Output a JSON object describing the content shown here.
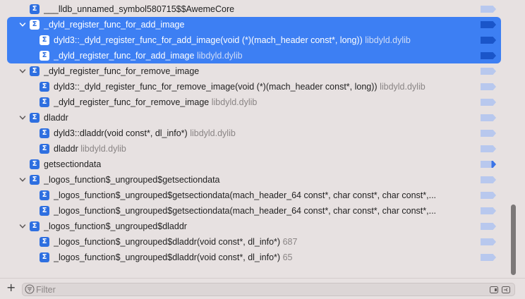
{
  "rows": [
    {
      "indent": 1,
      "disclosure": "none",
      "name": "___lldb_unnamed_symbol580715$$AwemeCore",
      "lib": "",
      "selected": false,
      "bp": "normal"
    },
    {
      "indent": 0,
      "disclosure": "open",
      "name": "_dyld_register_func_for_add_image",
      "lib": "",
      "selected": true,
      "bp": "normal"
    },
    {
      "indent": 2,
      "disclosure": "none",
      "name": "dyld3::_dyld_register_func_for_add_image(void (*)(mach_header const*, long))",
      "lib": "libdyld.dylib",
      "selected": true,
      "bp": "normal"
    },
    {
      "indent": 2,
      "disclosure": "none",
      "name": "_dyld_register_func_for_add_image",
      "lib": "libdyld.dylib",
      "selected": true,
      "bp": "normal"
    },
    {
      "indent": 0,
      "disclosure": "open",
      "name": "_dyld_register_func_for_remove_image",
      "lib": "",
      "selected": false,
      "bp": "normal"
    },
    {
      "indent": 2,
      "disclosure": "none",
      "name": "dyld3::_dyld_register_func_for_remove_image(void (*)(mach_header const*, long))",
      "lib": "libdyld.dylib",
      "selected": false,
      "bp": "normal"
    },
    {
      "indent": 2,
      "disclosure": "none",
      "name": "_dyld_register_func_for_remove_image",
      "lib": "libdyld.dylib",
      "selected": false,
      "bp": "normal"
    },
    {
      "indent": 0,
      "disclosure": "open",
      "name": "dladdr",
      "lib": "",
      "selected": false,
      "bp": "normal"
    },
    {
      "indent": 2,
      "disclosure": "none",
      "name": "dyld3::dladdr(void const*, dl_info*)",
      "lib": "libdyld.dylib",
      "selected": false,
      "bp": "normal"
    },
    {
      "indent": 2,
      "disclosure": "none",
      "name": "dladdr",
      "lib": "libdyld.dylib",
      "selected": false,
      "bp": "normal"
    },
    {
      "indent": 1,
      "disclosure": "none",
      "name": "getsectiondata",
      "lib": "",
      "selected": false,
      "bp": "partial"
    },
    {
      "indent": 0,
      "disclosure": "open",
      "name": "_logos_function$_ungrouped$getsectiondata",
      "lib": "",
      "selected": false,
      "bp": "normal"
    },
    {
      "indent": 2,
      "disclosure": "none",
      "name": "_logos_function$_ungrouped$getsectiondata(mach_header_64 const*, char const*, char const*,...",
      "lib": "",
      "selected": false,
      "bp": "normal"
    },
    {
      "indent": 2,
      "disclosure": "none",
      "name": "_logos_function$_ungrouped$getsectiondata(mach_header_64 const*, char const*, char const*,...",
      "lib": "",
      "selected": false,
      "bp": "normal"
    },
    {
      "indent": 0,
      "disclosure": "open",
      "name": "_logos_function$_ungrouped$dladdr",
      "lib": "",
      "selected": false,
      "bp": "normal"
    },
    {
      "indent": 2,
      "disclosure": "none",
      "name": "_logos_function$_ungrouped$dladdr(void const*, dl_info*)",
      "lib": "687",
      "selected": false,
      "bp": "normal"
    },
    {
      "indent": 2,
      "disclosure": "none",
      "name": "_logos_function$_ungrouped$dladdr(void const*, dl_info*)",
      "lib": "65",
      "selected": false,
      "bp": "normal"
    }
  ],
  "symbol_glyph": "Σ",
  "bottom": {
    "add_glyph": "+",
    "filter_placeholder": "Filter"
  },
  "colors": {
    "selection": "#3d7ff3",
    "symbol_badge": "#2e6fe0",
    "breakpoint": "#b8c8ee"
  },
  "icons": [
    "disclosure-chevron-icon",
    "symbol-icon",
    "breakpoint-icon",
    "filter-icon",
    "show-all-icon",
    "enabled-only-icon"
  ]
}
